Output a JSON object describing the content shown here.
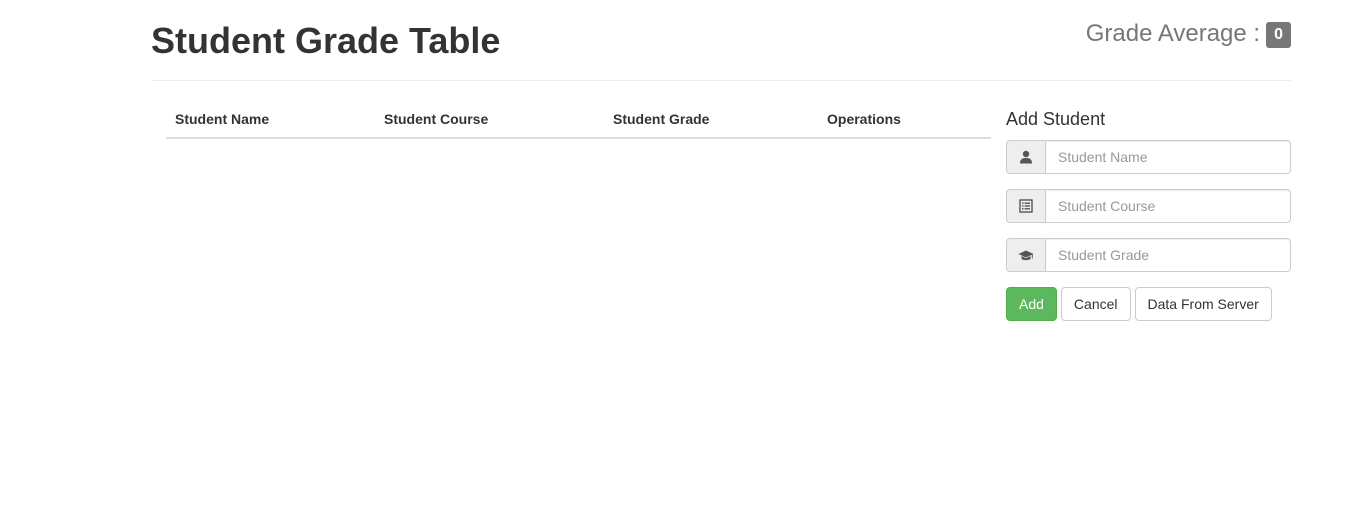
{
  "header": {
    "title": "Student Grade Table",
    "grade_average_label": "Grade Average :",
    "grade_average_value": "0"
  },
  "table": {
    "columns": [
      "Student Name",
      "Student Course",
      "Student Grade",
      "Operations"
    ],
    "rows": []
  },
  "form": {
    "title": "Add Student",
    "name_placeholder": "Student Name",
    "course_placeholder": "Student Course",
    "grade_placeholder": "Student Grade",
    "name_icon": "user-icon",
    "course_icon": "list-alt-icon",
    "grade_icon": "graduation-cap-icon",
    "add_label": "Add",
    "cancel_label": "Cancel",
    "server_label": "Data From Server"
  },
  "colors": {
    "success": "#5cb85c",
    "badge": "#777777"
  }
}
